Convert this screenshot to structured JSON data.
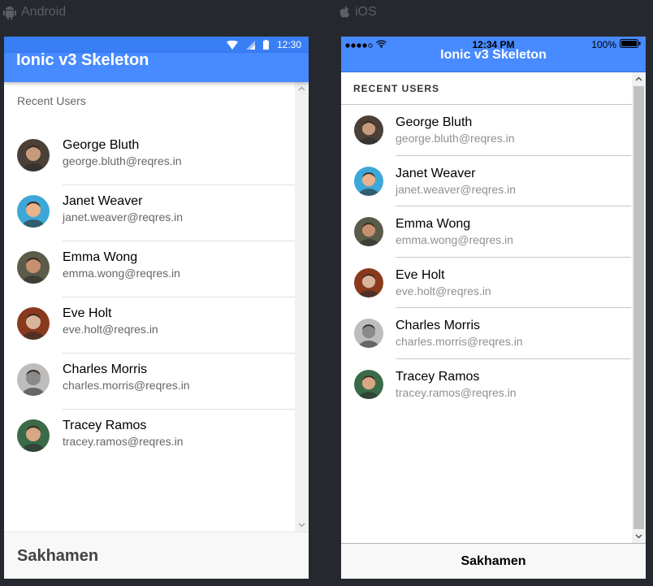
{
  "platforms": {
    "android_label": "Android",
    "ios_label": "iOS"
  },
  "android": {
    "status_time": "12:30",
    "toolbar_title": "Ionic v3 Skeleton",
    "list_header": "Recent Users",
    "footer_title": "Sakhamen",
    "colors": {
      "toolbar": "#488aff",
      "statusbar": "#387ef5"
    }
  },
  "ios": {
    "status_time": "12:34 PM",
    "battery": "100%",
    "navbar_title": "Ionic v3 Skeleton",
    "list_header": "RECENT USERS",
    "footer_title": "Sakhamen",
    "colors": {
      "navbar": "#488aff"
    }
  },
  "users": [
    {
      "name": "George Bluth",
      "email": "george.bluth@reqres.in",
      "avatar_color": "#4a4038",
      "skin": "#c89a7c"
    },
    {
      "name": "Janet Weaver",
      "email": "janet.weaver@reqres.in",
      "avatar_color": "#3da8d8",
      "skin": "#e8b28a"
    },
    {
      "name": "Emma Wong",
      "email": "emma.wong@reqres.in",
      "avatar_color": "#5b5b4a",
      "skin": "#c7906e"
    },
    {
      "name": "Eve Holt",
      "email": "eve.holt@reqres.in",
      "avatar_color": "#8a3a1c",
      "skin": "#d9b59c"
    },
    {
      "name": "Charles Morris",
      "email": "charles.morris@reqres.in",
      "avatar_color": "#bdbdbd",
      "skin": "#8a8a8a"
    },
    {
      "name": "Tracey Ramos",
      "email": "tracey.ramos@reqres.in",
      "avatar_color": "#3a6a48",
      "skin": "#d8a886"
    }
  ]
}
